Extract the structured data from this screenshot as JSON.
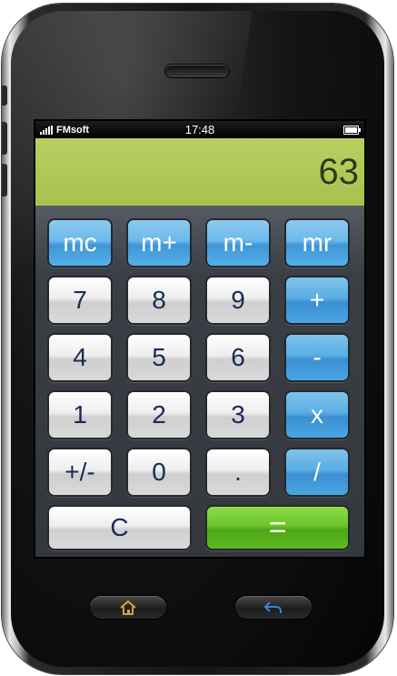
{
  "status": {
    "carrier": "FMsoft",
    "time": "17:48"
  },
  "display": {
    "value": "63"
  },
  "memory_keys": [
    "mc",
    "m+",
    "m-",
    "mr"
  ],
  "digit_keys": {
    "row1": [
      "7",
      "8",
      "9"
    ],
    "row2": [
      "4",
      "5",
      "6"
    ],
    "row3": [
      "1",
      "2",
      "3"
    ],
    "row4": [
      "+/-",
      "0",
      "."
    ]
  },
  "operator_keys": [
    "+",
    "-",
    "x",
    "/"
  ],
  "clear_key": "C",
  "equals_key": "=",
  "colors": {
    "display_bg": "#b4cb5c",
    "digit_text": "#1b2a55",
    "equals": "#5dba22",
    "operator": "#4aa6e2",
    "home_icon": "#d6a23a",
    "back_icon": "#3b7fd6"
  },
  "icons": {
    "home": "home-icon",
    "back": "back-arrow-icon",
    "battery": "battery-icon",
    "signal": "signal-icon"
  }
}
